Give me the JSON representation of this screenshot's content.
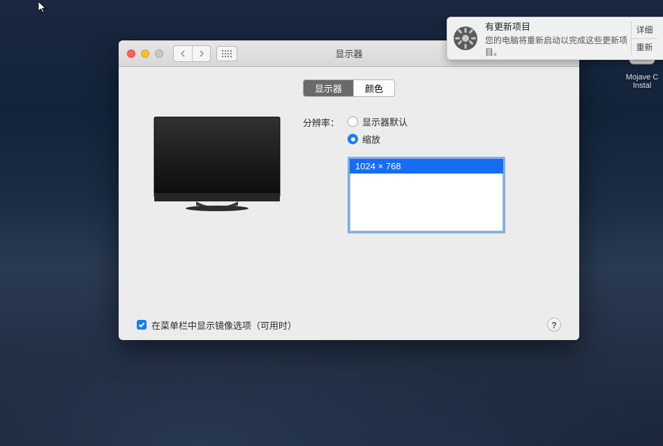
{
  "window": {
    "title": "显示器"
  },
  "tabs": {
    "display": "显示器",
    "color": "颜色"
  },
  "resolution": {
    "label": "分辨率：",
    "option_default": "显示器默认",
    "option_scaled": "缩放",
    "list": [
      "1024 × 768"
    ]
  },
  "footer": {
    "mirror_checkbox": "在菜单栏中显示镜像选项（可用时）"
  },
  "help": "?",
  "notification": {
    "title": "有更新项目",
    "body": "您的电脑将重新启动以完成这些更新项目。",
    "action_details": "详细",
    "action_restart": "重新"
  },
  "desktop": {
    "installer_line1": "Mojave C",
    "installer_line2": "Instal"
  }
}
